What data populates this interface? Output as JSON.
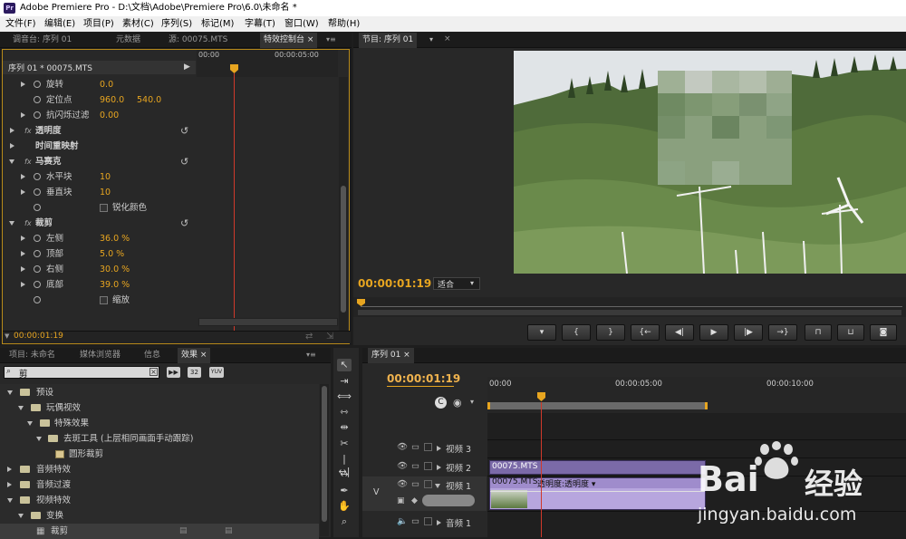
{
  "window": {
    "app_badge": "Pr",
    "title": "Adobe Premiere Pro - D:\\文档\\Adobe\\Premiere Pro\\6.0\\未命名 *"
  },
  "menu": [
    "文件(F)",
    "编辑(E)",
    "项目(P)",
    "素材(C)",
    "序列(S)",
    "标记(M)",
    "字幕(T)",
    "窗口(W)",
    "帮助(H)"
  ],
  "left_top_tabs": [
    "调音台: 序列 01",
    "元数据",
    "源: 00075.MTS",
    "特效控制台 ×"
  ],
  "effect_controls": {
    "header": "序列 01 * 00075.MTS",
    "ruler_start": "00:00",
    "ruler_mid": "00:00:05:00",
    "timecode": "00:00:01:19",
    "rows": [
      {
        "label": "旋转",
        "value": "0.0"
      },
      {
        "label": "定位点",
        "value": "960.0",
        "value2": "540.0"
      },
      {
        "label": "抗闪烁过滤",
        "value": "0.00"
      },
      {
        "label": "透明度"
      },
      {
        "label": "时间重映射"
      },
      {
        "label": "马赛克"
      },
      {
        "label": "水平块",
        "value": "10"
      },
      {
        "label": "垂直块",
        "value": "10"
      },
      {
        "label": "锐化颜色"
      },
      {
        "label": "裁剪"
      },
      {
        "label": "左侧",
        "value": "36.0 %"
      },
      {
        "label": "顶部",
        "value": "5.0 %"
      },
      {
        "label": "右侧",
        "value": "30.0 %"
      },
      {
        "label": "底部",
        "value": "39.0 %"
      },
      {
        "label": "缩放"
      }
    ]
  },
  "program_monitor": {
    "tab": "节目: 序列 01",
    "timecode": "00:00:01:19",
    "fit_label": "适合",
    "controls": [
      "marker",
      "in-point",
      "out-point",
      "go-to-in",
      "step-back",
      "play",
      "step-forward",
      "go-to-out",
      "lift",
      "extract",
      "export-frame"
    ]
  },
  "project_panel": {
    "tabs": [
      "项目: 未命名",
      "媒体浏览器",
      "信息",
      "效果 ×"
    ],
    "search_value": "剪",
    "badges": [
      "32",
      "YUV"
    ],
    "tree": [
      {
        "label": "预设"
      },
      {
        "label": "玩偶视效"
      },
      {
        "label": "特殊效果"
      },
      {
        "label": "去斑工具 (上层相同画面手动跟踪)"
      },
      {
        "label": "圆形裁剪"
      },
      {
        "label": "音频特效"
      },
      {
        "label": "音频过渡"
      },
      {
        "label": "视频特效"
      },
      {
        "label": "变换"
      },
      {
        "label": "裁剪"
      }
    ]
  },
  "timeline": {
    "tab": "序列 01 ×",
    "timecode": "00:00:01:19",
    "ruler_start": "00:00",
    "ruler_mid": "00:00:05:00",
    "ruler_end": "00:00:10:00",
    "tracks": [
      {
        "name": "视频 3"
      },
      {
        "name": "视频 2"
      },
      {
        "name": "视频 1"
      },
      {
        "name": "音频 1"
      }
    ],
    "video_target": "V",
    "clip_v2": "00075.MTS",
    "clip_v1": "00075.MTS",
    "clip_v1_effect": "透明度:透明度 ▾"
  },
  "watermark": {
    "brand": "Bai",
    "suffix": "经验",
    "url": "jingyan.baidu.com"
  },
  "colors": {
    "timecode": "#e7a520",
    "playhead": "#d0392b",
    "clip_v2": "#7b6aa8",
    "clip_v1": "#b7a6de",
    "highlight_border": "#b88a1a"
  }
}
